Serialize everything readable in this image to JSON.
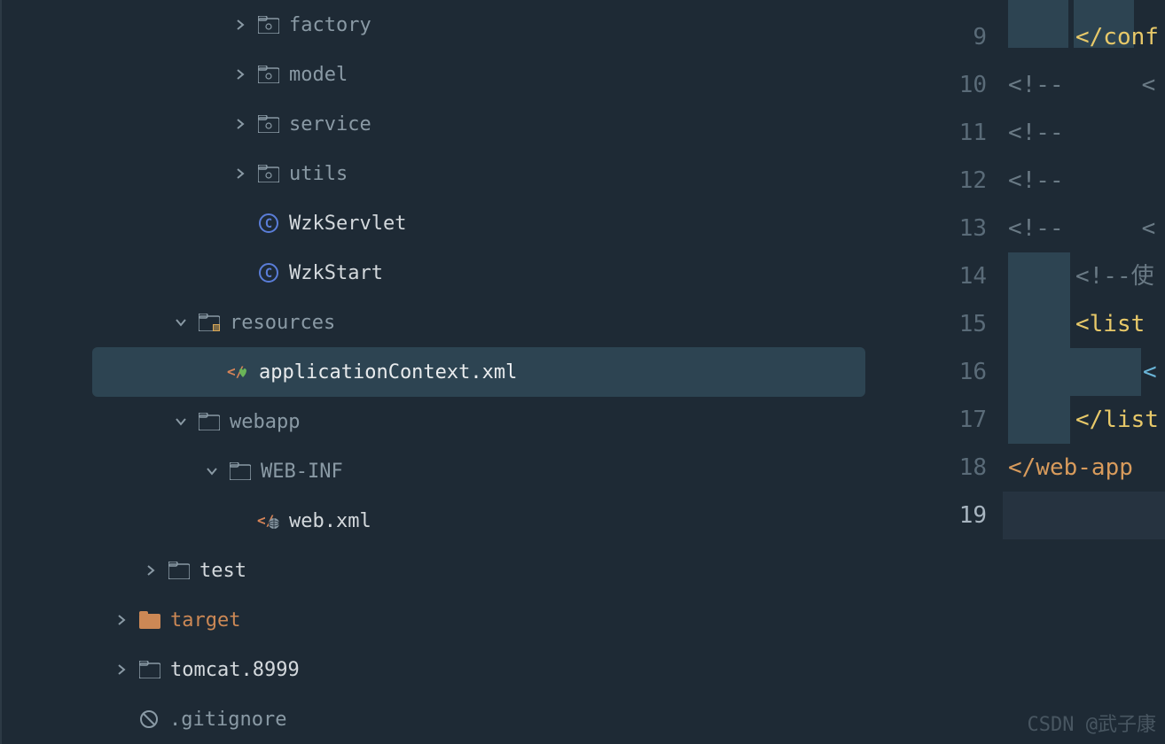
{
  "tree": {
    "factory": "factory",
    "model": "model",
    "service": "service",
    "utils": "utils",
    "wzkServlet": "WzkServlet",
    "wzkStart": "WzkStart",
    "resources": "resources",
    "applicationContext": "applicationContext.xml",
    "webapp": "webapp",
    "webInf": "WEB-INF",
    "webXml": "web.xml",
    "test": "test",
    "target": "target",
    "tomcat": "tomcat.8999",
    "gitignore": ".gitignore"
  },
  "editor": {
    "lines": [
      {
        "num": "9",
        "type": "endtag",
        "text": "</conf",
        "indent": 2
      },
      {
        "num": "10",
        "type": "comment",
        "text": "<!--",
        "text2": "<",
        "indent": 0
      },
      {
        "num": "11",
        "type": "comment",
        "text": "<!--",
        "indent": 0
      },
      {
        "num": "12",
        "type": "comment",
        "text": "<!--",
        "indent": 0
      },
      {
        "num": "13",
        "type": "comment",
        "text": "<!--",
        "text2": "<",
        "indent": 0
      },
      {
        "num": "14",
        "type": "comment",
        "text": "<!--使",
        "indent": 2,
        "hl": true
      },
      {
        "num": "15",
        "type": "tag",
        "text": "<list",
        "indent": 2,
        "hl": true
      },
      {
        "num": "16",
        "type": "bracket",
        "text": "<",
        "indent": 4,
        "hl": true
      },
      {
        "num": "17",
        "type": "endtag",
        "text": "</list",
        "indent": 2,
        "hl": true
      },
      {
        "num": "18",
        "type": "endweb",
        "text": "</web-app",
        "indent": 0
      },
      {
        "num": "19",
        "type": "empty",
        "text": "",
        "current": true
      }
    ]
  },
  "watermark": "CSDN @武子康"
}
